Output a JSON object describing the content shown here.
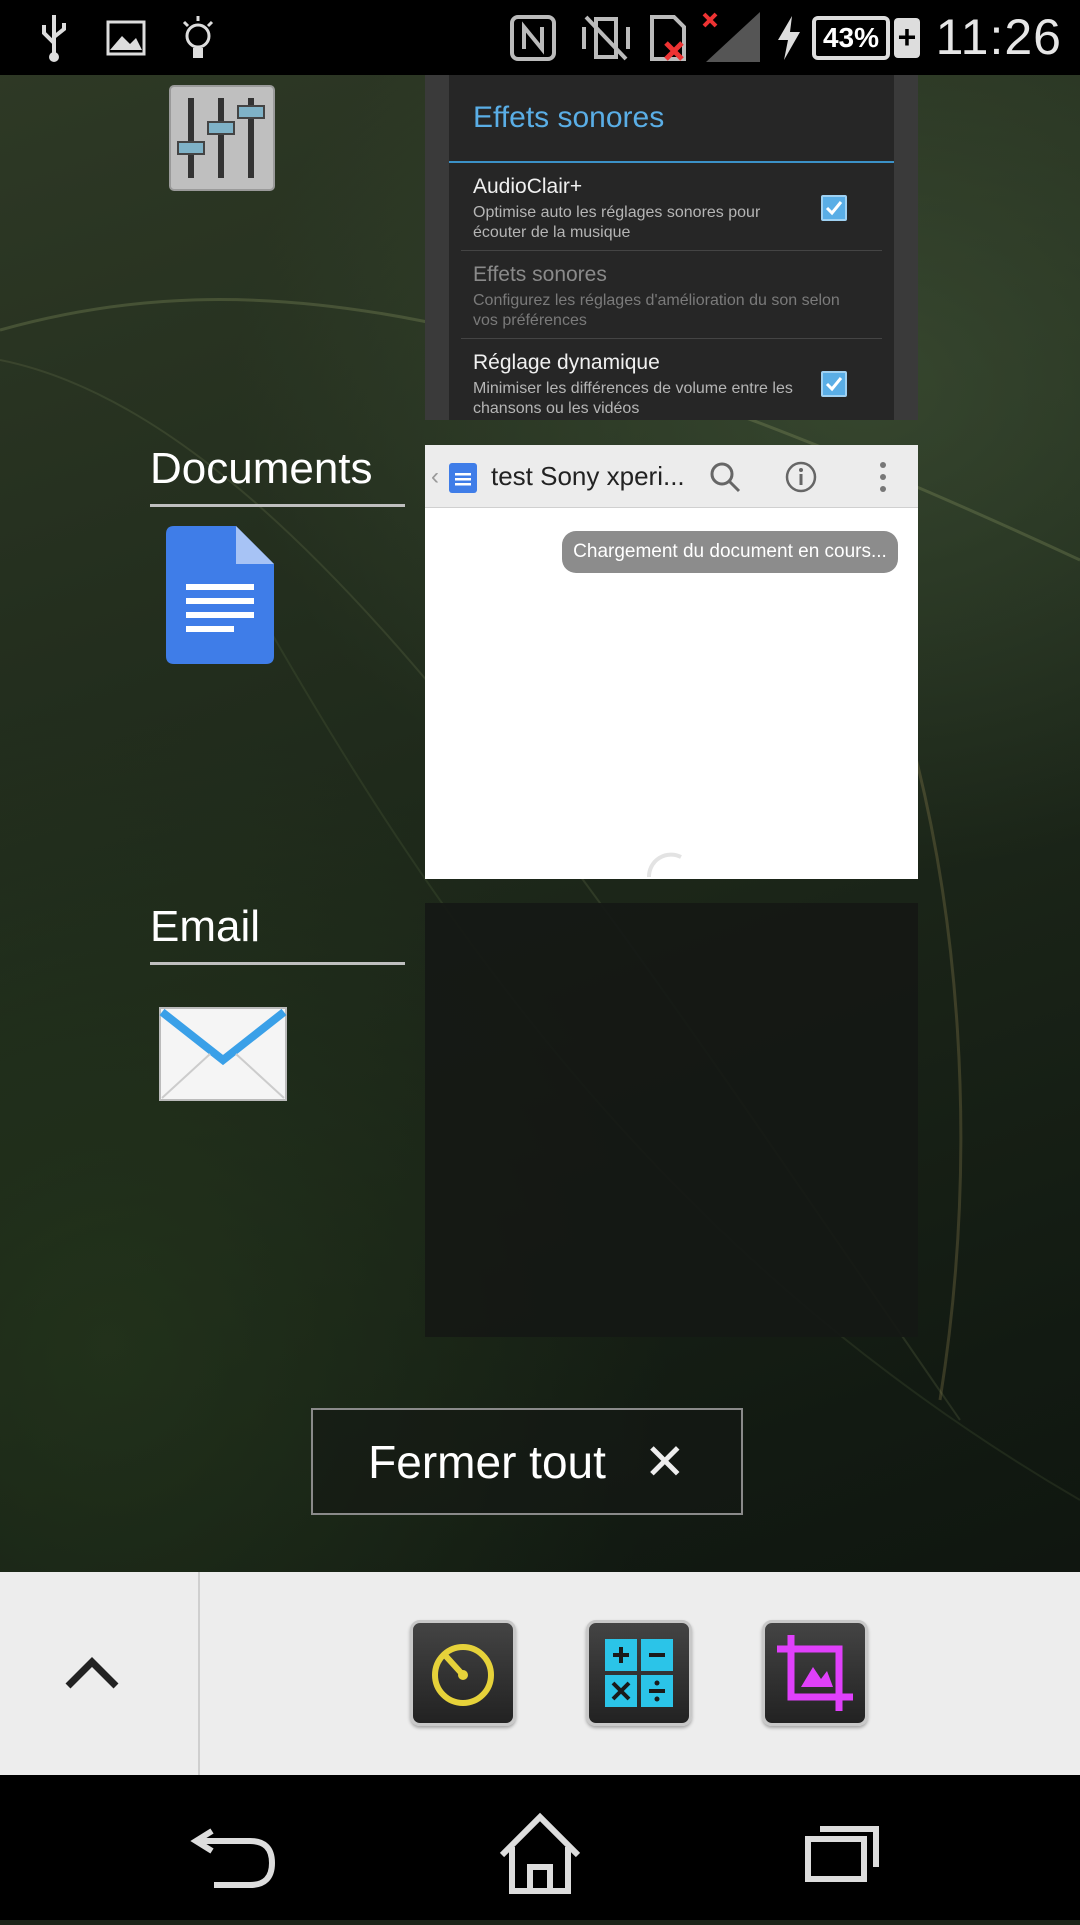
{
  "status_bar": {
    "time": "11:26",
    "battery": "43%",
    "icons": [
      "usb-icon",
      "image-icon",
      "lightbulb-icon",
      "nfc-icon",
      "vibrate-off-icon",
      "no-sim-icon",
      "signal-icon",
      "charging-icon"
    ]
  },
  "recent_apps": [
    {
      "app_name": "",
      "icon": "equalizer-icon",
      "dialog": {
        "title": "Effets sonores",
        "prefs": [
          {
            "title": "AudioClair+",
            "summary": "Optimise auto les réglages sonores pour écouter de la musique",
            "checked": true
          },
          {
            "title": "Effets sonores",
            "summary": "Configurez les réglages d'amélioration du son selon vos préférences",
            "enabled": false
          },
          {
            "title": "Réglage dynamique",
            "summary": "Minimiser les différences de volume entre les chansons ou les vidéos",
            "checked": true
          }
        ]
      }
    },
    {
      "app_name": "Documents",
      "icon": "google-docs-icon",
      "doc_title": "test Sony xperi...",
      "toast": "Chargement du document en cours..."
    },
    {
      "app_name": "Email",
      "icon": "envelope-icon"
    }
  ],
  "close_all": {
    "label": "Fermer tout"
  },
  "small_apps": [
    {
      "name": "timer",
      "icon": "timer-icon"
    },
    {
      "name": "calculator",
      "icon": "calculator-icon"
    },
    {
      "name": "screen-clip",
      "icon": "crop-image-icon"
    }
  ],
  "colors": {
    "accent": "#5aaee6",
    "docs_blue": "#4285f4",
    "crop_magenta": "#e040fb",
    "timer_yellow": "#e6d23a",
    "calc_cyan": "#2bc4e8"
  }
}
